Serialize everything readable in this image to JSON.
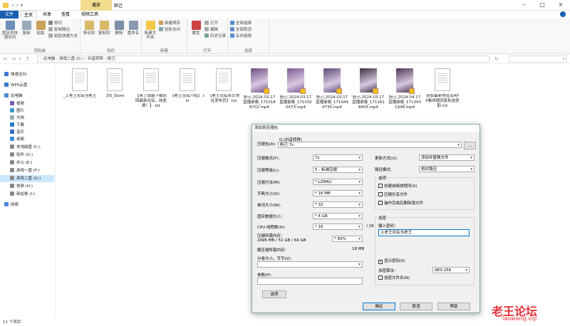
{
  "window": {
    "context_tab": "播放",
    "title": "妲己"
  },
  "ribbon_tabs": [
    {
      "label": "文件"
    },
    {
      "label": "主页"
    },
    {
      "label": "共享"
    },
    {
      "label": "查看"
    },
    {
      "label": "视频工具"
    }
  ],
  "ribbon": {
    "clipboard": {
      "pin": "固定到快速访问",
      "copy": "复制",
      "paste": "粘贴",
      "cut": "剪切",
      "copy_path": "复制路径",
      "paste_shortcut": "粘贴快捷方式",
      "group": "剪贴板"
    },
    "organize": {
      "move_to": "移动到",
      "copy_to": "复制到",
      "delete": "删除",
      "rename": "重命名",
      "group": "组织"
    },
    "new": {
      "new_folder": "新建文件夹",
      "new_item": "新建项目",
      "easy_access": "轻松访问",
      "group": "新建"
    },
    "open": {
      "properties": "属性",
      "open": "打开",
      "edit": "编辑",
      "history": "历史记录",
      "group": "打开"
    },
    "select": {
      "select_all": "全部选择",
      "select_none": "全部取消",
      "invert": "反向选择",
      "group": "选择"
    }
  },
  "address": {
    "path": "›  此电脑  ›  游戏二盘 (G:)  ›  抖音转移  ›  妲己"
  },
  "sidebar": [
    {
      "label": "快速访问",
      "icon": "star-icon"
    },
    {
      "label": "WPS云盘",
      "icon": "cloud-icon"
    },
    {
      "label": "此电脑",
      "icon": "computer-icon"
    },
    {
      "label": "视频",
      "icon": "video-icon"
    },
    {
      "label": "图片",
      "icon": "picture-icon"
    },
    {
      "label": "文档",
      "icon": "document-icon"
    },
    {
      "label": "下载",
      "icon": "download-icon"
    },
    {
      "label": "音乐",
      "icon": "music-icon"
    },
    {
      "label": "桌面",
      "icon": "desktop-icon"
    },
    {
      "label": "本地磁盘 (C:)",
      "icon": "drive-icon"
    },
    {
      "label": "软件 (D:)",
      "icon": "drive-icon"
    },
    {
      "label": "办公 (E:)",
      "icon": "drive-icon"
    },
    {
      "label": "游戏一盘 (F:)",
      "icon": "drive-icon"
    },
    {
      "label": "游戏二盘 (G:)",
      "icon": "drive-icon"
    },
    {
      "label": "视频 (H:)",
      "icon": "drive-icon"
    },
    {
      "label": "新加卷 (I:)",
      "icon": "drive-icon"
    },
    {
      "label": "网络",
      "icon": "network-icon"
    }
  ],
  "files": [
    {
      "name": "_上老王论坛当老王",
      "kind": "doc"
    },
    {
      "name": ".DS_Store",
      "kind": "doc"
    },
    {
      "name": "【来了就能下载轮回最新论坛，纯免费！】.txt",
      "kind": "doc"
    },
    {
      "name": "【老王论坛介绍】.txt",
      "kind": "doc"
    },
    {
      "name": "【老王论坛永久地址发布页】.txt",
      "kind": "doc"
    },
    {
      "name": "妲己.2024.03.17直播录像_1710148702.mp4",
      "kind": "video",
      "color": "#6e4d86"
    },
    {
      "name": "妲己.2024.03.17直播录像_1710320473.mp4",
      "kind": "video",
      "color": "#7a5a92"
    },
    {
      "name": "妲己.2024.03.17直播录像_1710494730.mp4",
      "kind": "video",
      "color": "#5e4a78"
    },
    {
      "name": "妲己.2024.03.17直播录像_1711618405.mp4",
      "kind": "video",
      "color": "#3e3040"
    },
    {
      "name": "妲己.2024.04.17直播录像_1713431948.mp4",
      "kind": "video",
      "color": "#4a3550"
    },
    {
      "name": "获取最新地址及APP离线版回复私信获取.txt",
      "kind": "doc"
    }
  ],
  "status": {
    "count": "11 个项目"
  },
  "dialog": {
    "title": "添加到压缩包",
    "archive_label": "压缩包(A):",
    "archive_dir": "G:\\抖音转移\\",
    "archive_name": "妲己.7z",
    "browse": "...",
    "format_label": "压缩格式(F):",
    "format": "7z",
    "level_label": "压缩等级(L):",
    "level": "5 - 标准压缩",
    "method_label": "压缩方法(M):",
    "method": "* LZMA2",
    "dict_label": "字典大小(D):",
    "dict": "* 16 MB",
    "word_label": "单词大小(W):",
    "word": "* 32",
    "solid_label": "固实数据大小：",
    "solid": "* 4 GB",
    "cpu_label": "CPU 线程数(H):",
    "cpu": "* 16",
    "cpu_total": "/ 16",
    "mem_label": "压缩所需内存：",
    "mem_detail": "2496 MB / 51 GB / 64 GB",
    "mem_pct": "* 80%",
    "decomp_label": "解压缩所需内存：",
    "decomp": "18 MB",
    "split_label": "分卷大小，字节(V):",
    "params_label": "参数(P):",
    "options_btn": "选项",
    "update_label": "更新方式(U):",
    "update": "添加并替换文件",
    "path_label": "路径模式:",
    "path_mode": "相对路径",
    "opts_group": "选项",
    "opt1": "创建自释放程序(X)",
    "opt2": "压缩共享文件",
    "opt3": "操作完成后删除源文件",
    "enc_group": "加密",
    "pwd_label": "输入密码：",
    "pwd": "上老王论坛当老王",
    "show_pwd": "显示密码(S)",
    "enc_method_label": "加密算法：",
    "enc_method": "AES-256",
    "enc_names": "加密文件名(N)",
    "ok": "确定",
    "cancel": "取消",
    "help": "帮助"
  },
  "watermark": {
    "text": "老王论坛",
    "url": "laowang.vip"
  }
}
